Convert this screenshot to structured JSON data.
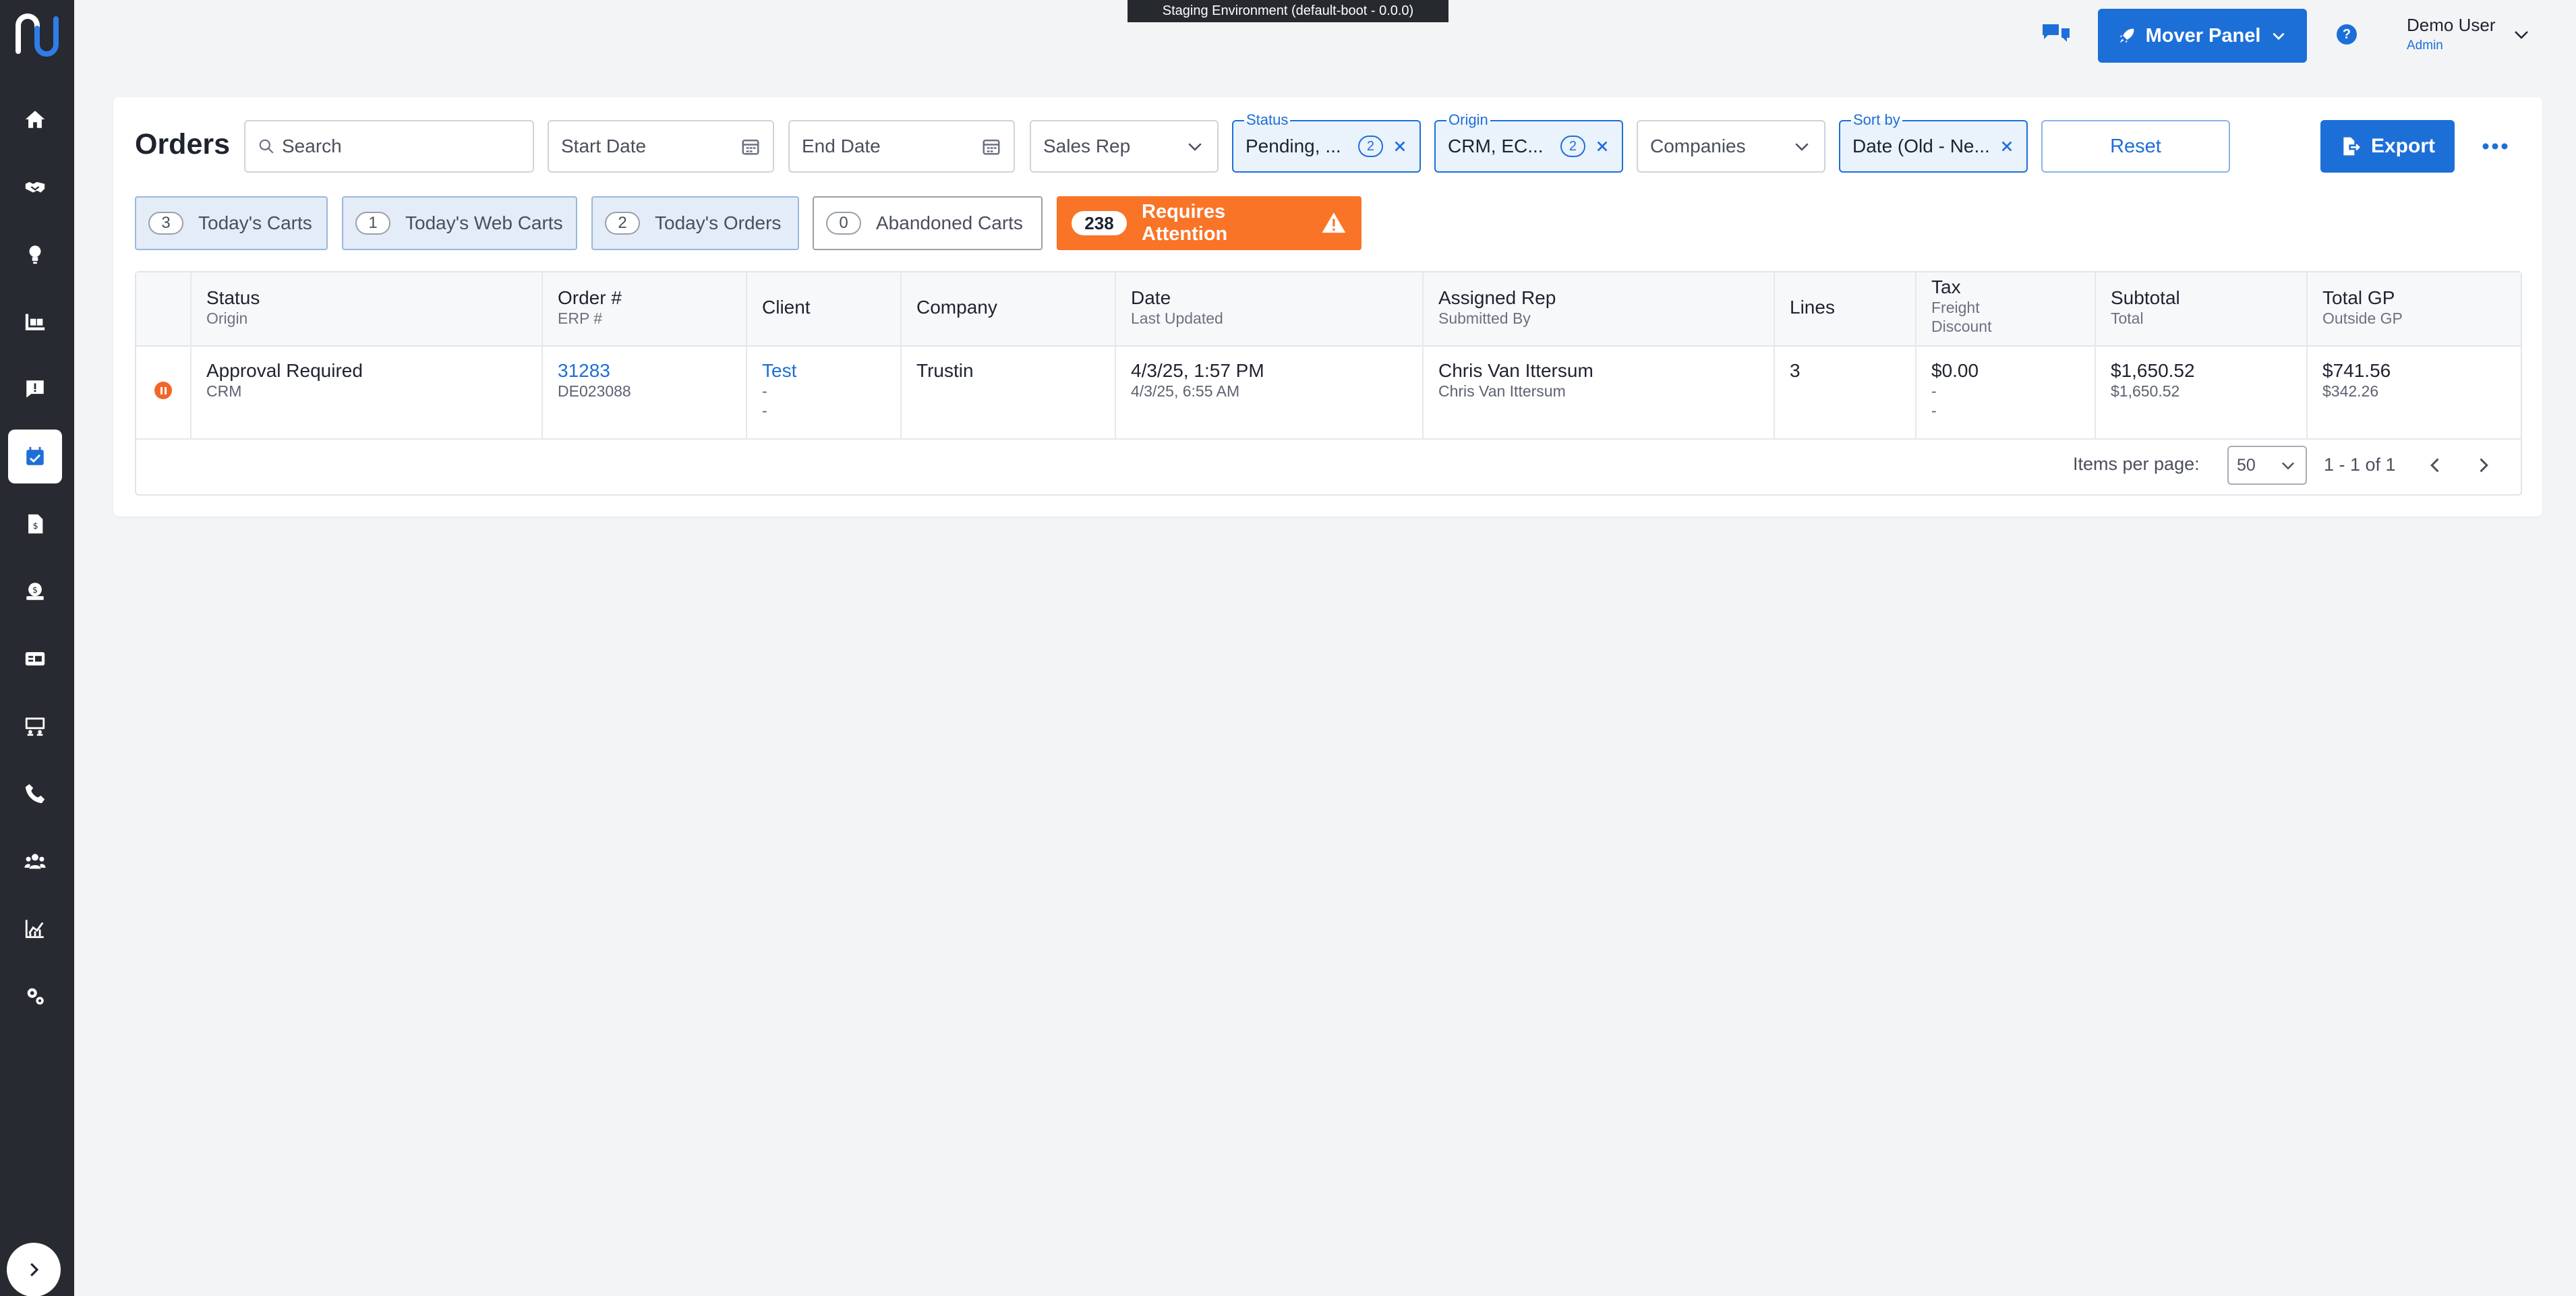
{
  "banner": "Staging Environment (default-boot - 0.0.0)",
  "sidebar": {
    "items": [
      {
        "icon": "home-icon"
      },
      {
        "icon": "handshake-icon"
      },
      {
        "icon": "lightbulb-icon"
      },
      {
        "icon": "warehouse-icon"
      },
      {
        "icon": "message-alert-icon"
      },
      {
        "icon": "calendar-check-icon",
        "active": true
      },
      {
        "icon": "invoice-icon"
      },
      {
        "icon": "money-icon"
      },
      {
        "icon": "id-card-icon"
      },
      {
        "icon": "presentation-icon"
      },
      {
        "icon": "phone-icon"
      },
      {
        "icon": "users-icon"
      },
      {
        "icon": "chart-icon"
      },
      {
        "icon": "settings-icon"
      }
    ]
  },
  "header": {
    "mover_panel_label": "Mover Panel",
    "help_label": "?",
    "user_name": "Demo User",
    "user_role": "Admin"
  },
  "page": {
    "title": "Orders"
  },
  "filters": {
    "search_placeholder": "Search",
    "start_date": "Start Date",
    "end_date": "End Date",
    "sales_rep": "Sales Rep",
    "status": {
      "legend": "Status",
      "value": "Pending, ...",
      "count": "2"
    },
    "origin": {
      "legend": "Origin",
      "value": "CRM, EC...",
      "count": "2"
    },
    "companies": "Companies",
    "sort": {
      "legend": "Sort by",
      "value": "Date (Old - Ne..."
    },
    "reset_label": "Reset",
    "export_label": "Export"
  },
  "quick_filters": [
    {
      "count": "3",
      "label": "Today's Carts"
    },
    {
      "count": "1",
      "label": "Today's Web Carts"
    },
    {
      "count": "2",
      "label": "Today's Orders"
    },
    {
      "count": "0",
      "label": "Abandoned Carts"
    },
    {
      "count": "238",
      "label": "Requires Attention"
    }
  ],
  "table": {
    "headers": [
      {
        "main": "Status",
        "sub": "Origin"
      },
      {
        "main": "Order #",
        "sub": "ERP #"
      },
      {
        "main": "Client",
        "sub": ""
      },
      {
        "main": "Company",
        "sub": ""
      },
      {
        "main": "Date",
        "sub": "Last Updated"
      },
      {
        "main": "Assigned Rep",
        "sub": "Submitted By"
      },
      {
        "main": "Lines",
        "sub": ""
      },
      {
        "main": "Tax",
        "sub": "Freight",
        "sub2": "Discount"
      },
      {
        "main": "Subtotal",
        "sub": "Total"
      },
      {
        "main": "Total GP",
        "sub": "Outside GP"
      }
    ],
    "rows": [
      {
        "status": "Approval Required",
        "origin": "CRM",
        "order_no": "31283",
        "erp_no": "DE023088",
        "client": "Test",
        "client_sub1": "-",
        "client_sub2": "-",
        "company": "Trustin",
        "date": "4/3/25, 1:57 PM",
        "last_updated": "4/3/25, 6:55 AM",
        "assigned_rep": "Chris Van Ittersum",
        "submitted_by": "Chris Van Ittersum",
        "lines": "3",
        "tax": "$0.00",
        "freight": "-",
        "discount": "-",
        "subtotal": "$1,650.52",
        "total": "$1,650.52",
        "total_gp": "$741.56",
        "outside_gp": "$342.26"
      }
    ]
  },
  "pagination": {
    "items_per_page_label": "Items per page:",
    "items_per_page": "50",
    "range": "1 - 1 of 1"
  },
  "colors": {
    "sidebar": "#272a30",
    "accent": "#1d6fd8",
    "alert": "#f97427"
  }
}
